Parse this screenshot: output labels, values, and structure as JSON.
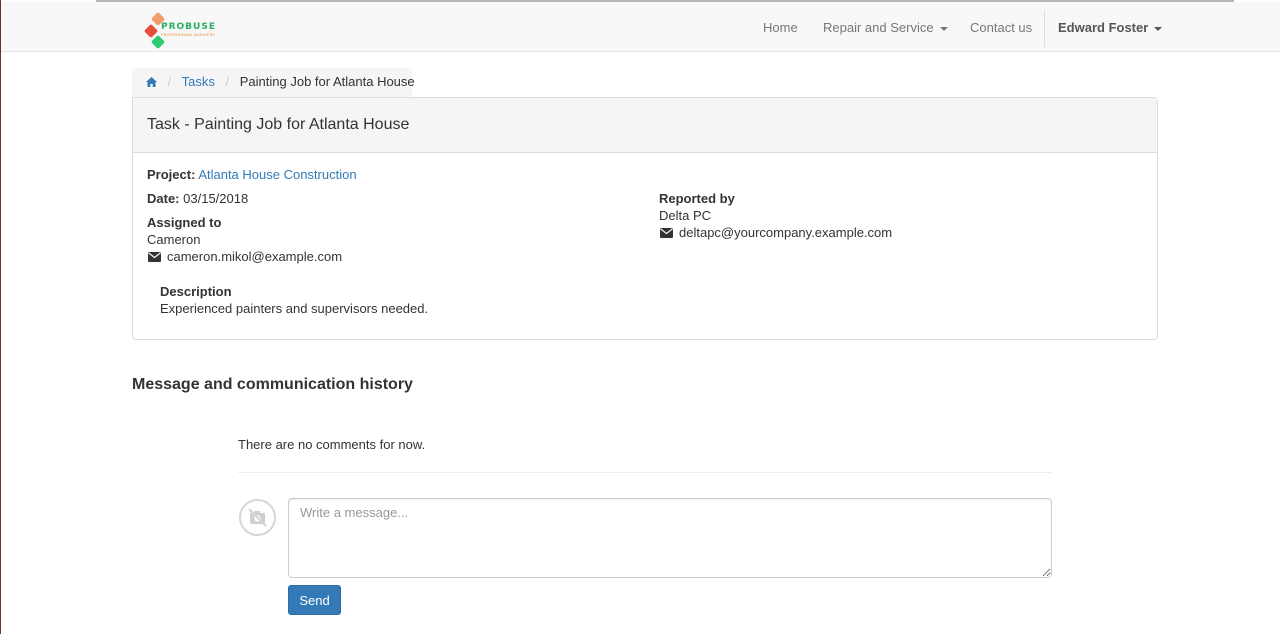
{
  "brand": {
    "name": "PROBUSE",
    "tagline": "PROFESSIONAL BUSINESS"
  },
  "nav": {
    "home": "Home",
    "repair": "Repair and Service",
    "contact": "Contact us",
    "user": "Edward Foster"
  },
  "breadcrumb": {
    "home_icon": "home-icon",
    "tasks": "Tasks",
    "current": "Painting Job for Atlanta House"
  },
  "task": {
    "heading": "Task - Painting Job for Atlanta House",
    "project_label": "Project:",
    "project_value": "Atlanta House Construction",
    "date_label": "Date:",
    "date_value": "03/15/2018",
    "assigned_label": "Assigned to",
    "assigned_name": "Cameron",
    "assigned_email": "cameron.mikol@example.com",
    "reported_label": "Reported by",
    "reported_name": "Delta PC",
    "reported_email": "deltapc@yourcompany.example.com",
    "description_label": "Description",
    "description_text": "Experienced painters and supervisors needed."
  },
  "history": {
    "title": "Message and communication history",
    "empty_text": "There are no comments for now.",
    "placeholder": "Write a message...",
    "send_label": "Send"
  },
  "colors": {
    "link": "#337ab7",
    "button": "#337ab7",
    "navbar": "#f8f8f8"
  }
}
